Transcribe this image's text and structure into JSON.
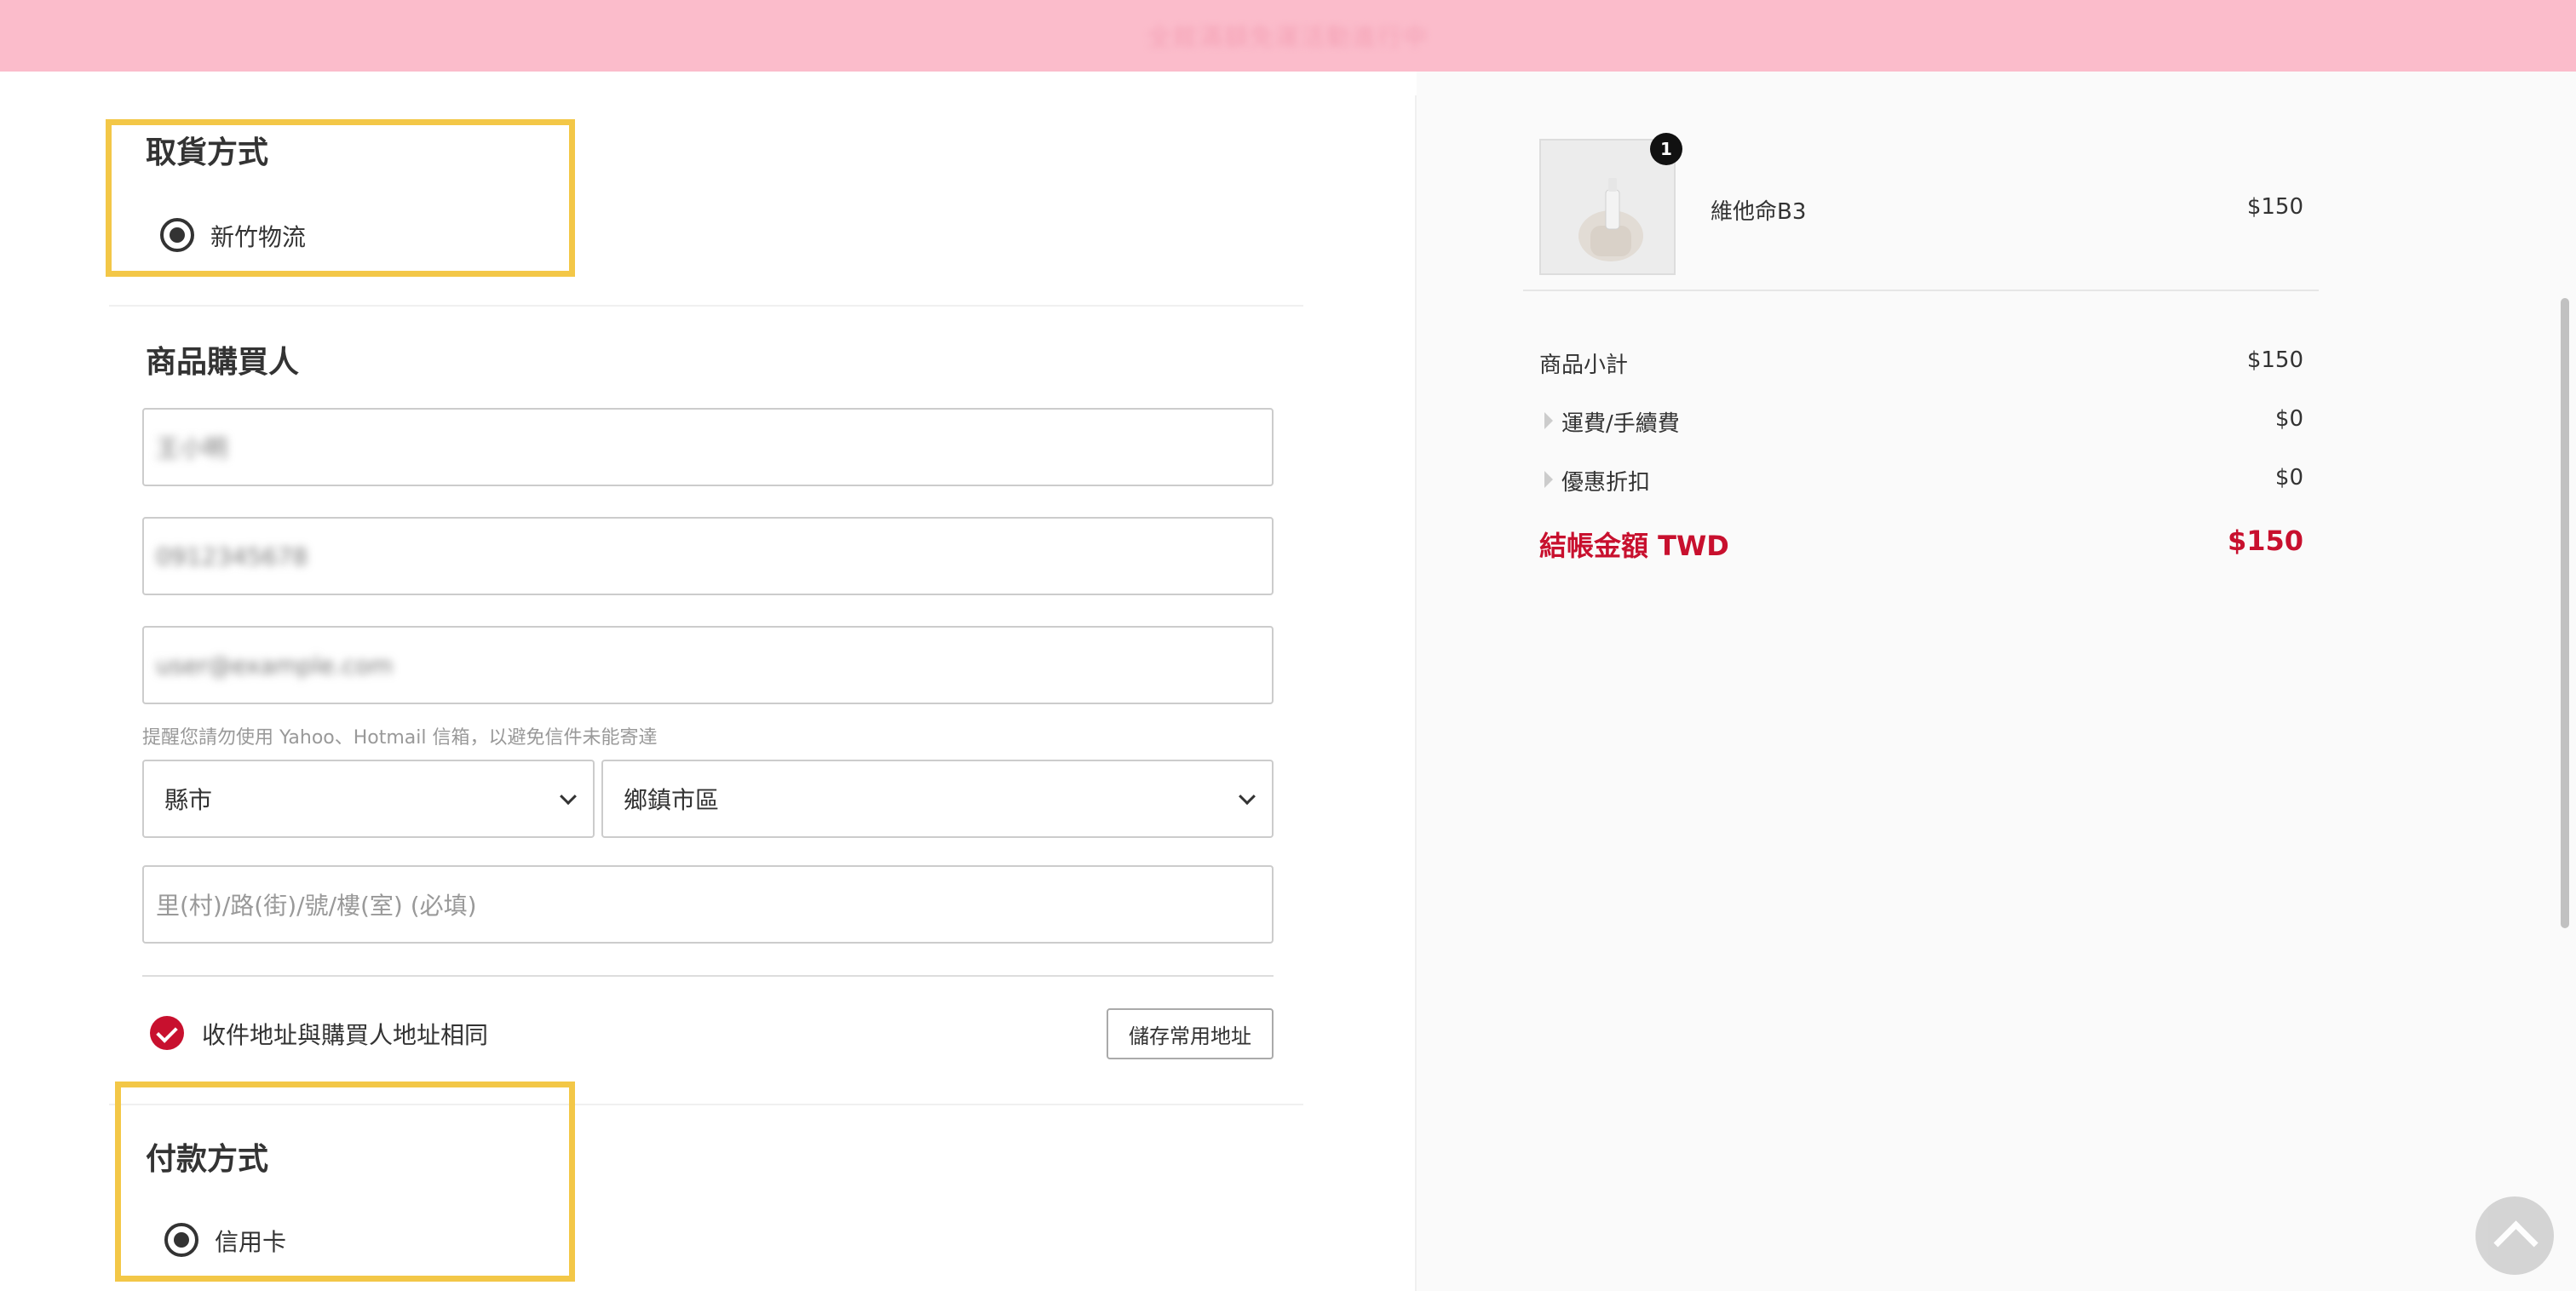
{
  "announcement": {
    "text": "全館滿額免運活動進行中"
  },
  "pickup": {
    "title": "取貨方式",
    "option_label": "新竹物流"
  },
  "buyer": {
    "title": "商品購買人",
    "name_value": "王小明",
    "phone_value": "0912345678",
    "email_value": "user@example.com",
    "email_hint": "提醒您請勿使用 Yahoo、Hotmail 信箱，以避免信件未能寄達",
    "county_select": "縣市",
    "district_select": "鄉鎮市區",
    "address_placeholder": "里(村)/路(街)/號/樓(室) (必填)",
    "same_address_label": "收件地址與購買人地址相同",
    "save_address_button": "儲存常用地址"
  },
  "payment": {
    "title": "付款方式",
    "option_label": "信用卡"
  },
  "cart": {
    "item": {
      "quantity_badge": "1",
      "name": "維他命B3",
      "price": "$150"
    }
  },
  "summary": {
    "subtotal_label": "商品小計",
    "subtotal_value": "$150",
    "shipping_label": "運費/手續費",
    "shipping_value": "$0",
    "discount_label": "優惠折扣",
    "discount_value": "$0",
    "total_label": "結帳金額 TWD",
    "total_value": "$150"
  },
  "colors": {
    "accent": "#c8102e",
    "banner": "#fbbccb",
    "highlight": "#f3c747"
  },
  "icons": {
    "back_to_top": "chevron-up-icon",
    "select_arrow": "chevron-down-icon",
    "check": "check-icon"
  }
}
